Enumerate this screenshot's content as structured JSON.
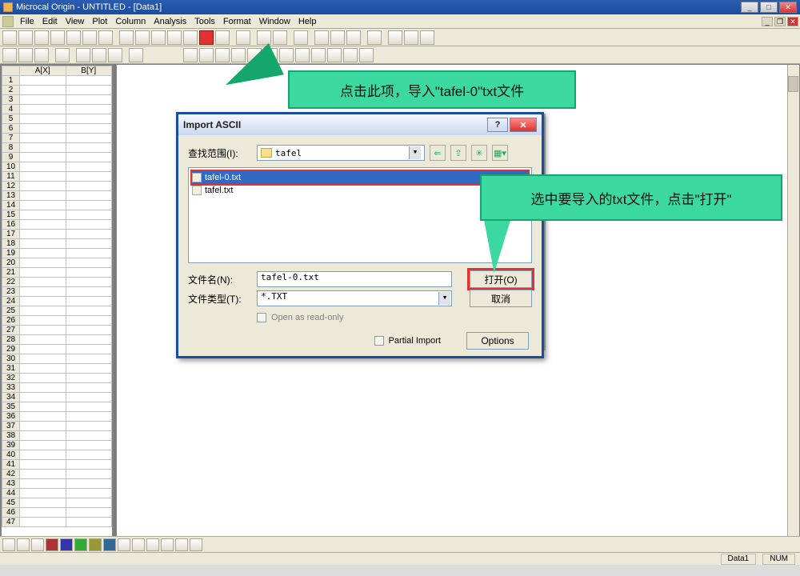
{
  "app": {
    "title": "Microcal Origin - UNTITLED - [Data1]"
  },
  "menu": {
    "file": "File",
    "edit": "Edit",
    "view": "View",
    "plot": "Plot",
    "column": "Column",
    "analysis": "Analysis",
    "tools": "Tools",
    "format": "Format",
    "window": "Window",
    "help": "Help"
  },
  "sheet": {
    "colA": "A[X]",
    "colB": "B[Y]",
    "rows": [
      "1",
      "2",
      "3",
      "4",
      "5",
      "6",
      "7",
      "8",
      "9",
      "10",
      "11",
      "12",
      "13",
      "14",
      "15",
      "16",
      "17",
      "18",
      "19",
      "20",
      "21",
      "22",
      "23",
      "24",
      "25",
      "26",
      "27",
      "28",
      "29",
      "30",
      "31",
      "32",
      "33",
      "34",
      "35",
      "36",
      "37",
      "38",
      "39",
      "40",
      "41",
      "42",
      "43",
      "44",
      "45",
      "46",
      "47"
    ]
  },
  "callout1": "点击此项，导入\"tafel-0\"txt文件",
  "callout2": "选中要导入的txt文件，点击\"打开\"",
  "dialog": {
    "title": "Import ASCII",
    "lookin_label": "查找范围(I):",
    "lookin_value": "tafel",
    "files": {
      "selected": "tafel-0.txt",
      "other": "tafel.txt"
    },
    "filename_label": "文件名(N):",
    "filename_value": "tafel-0.txt",
    "filetype_label": "文件类型(T):",
    "filetype_value": "*.TXT",
    "readonly": "Open as read-only",
    "partial": "Partial Import",
    "open": "打开(O)",
    "cancel": "取消",
    "options": "Options"
  },
  "status": {
    "cell1": "Data1",
    "cell2": "NUM"
  }
}
